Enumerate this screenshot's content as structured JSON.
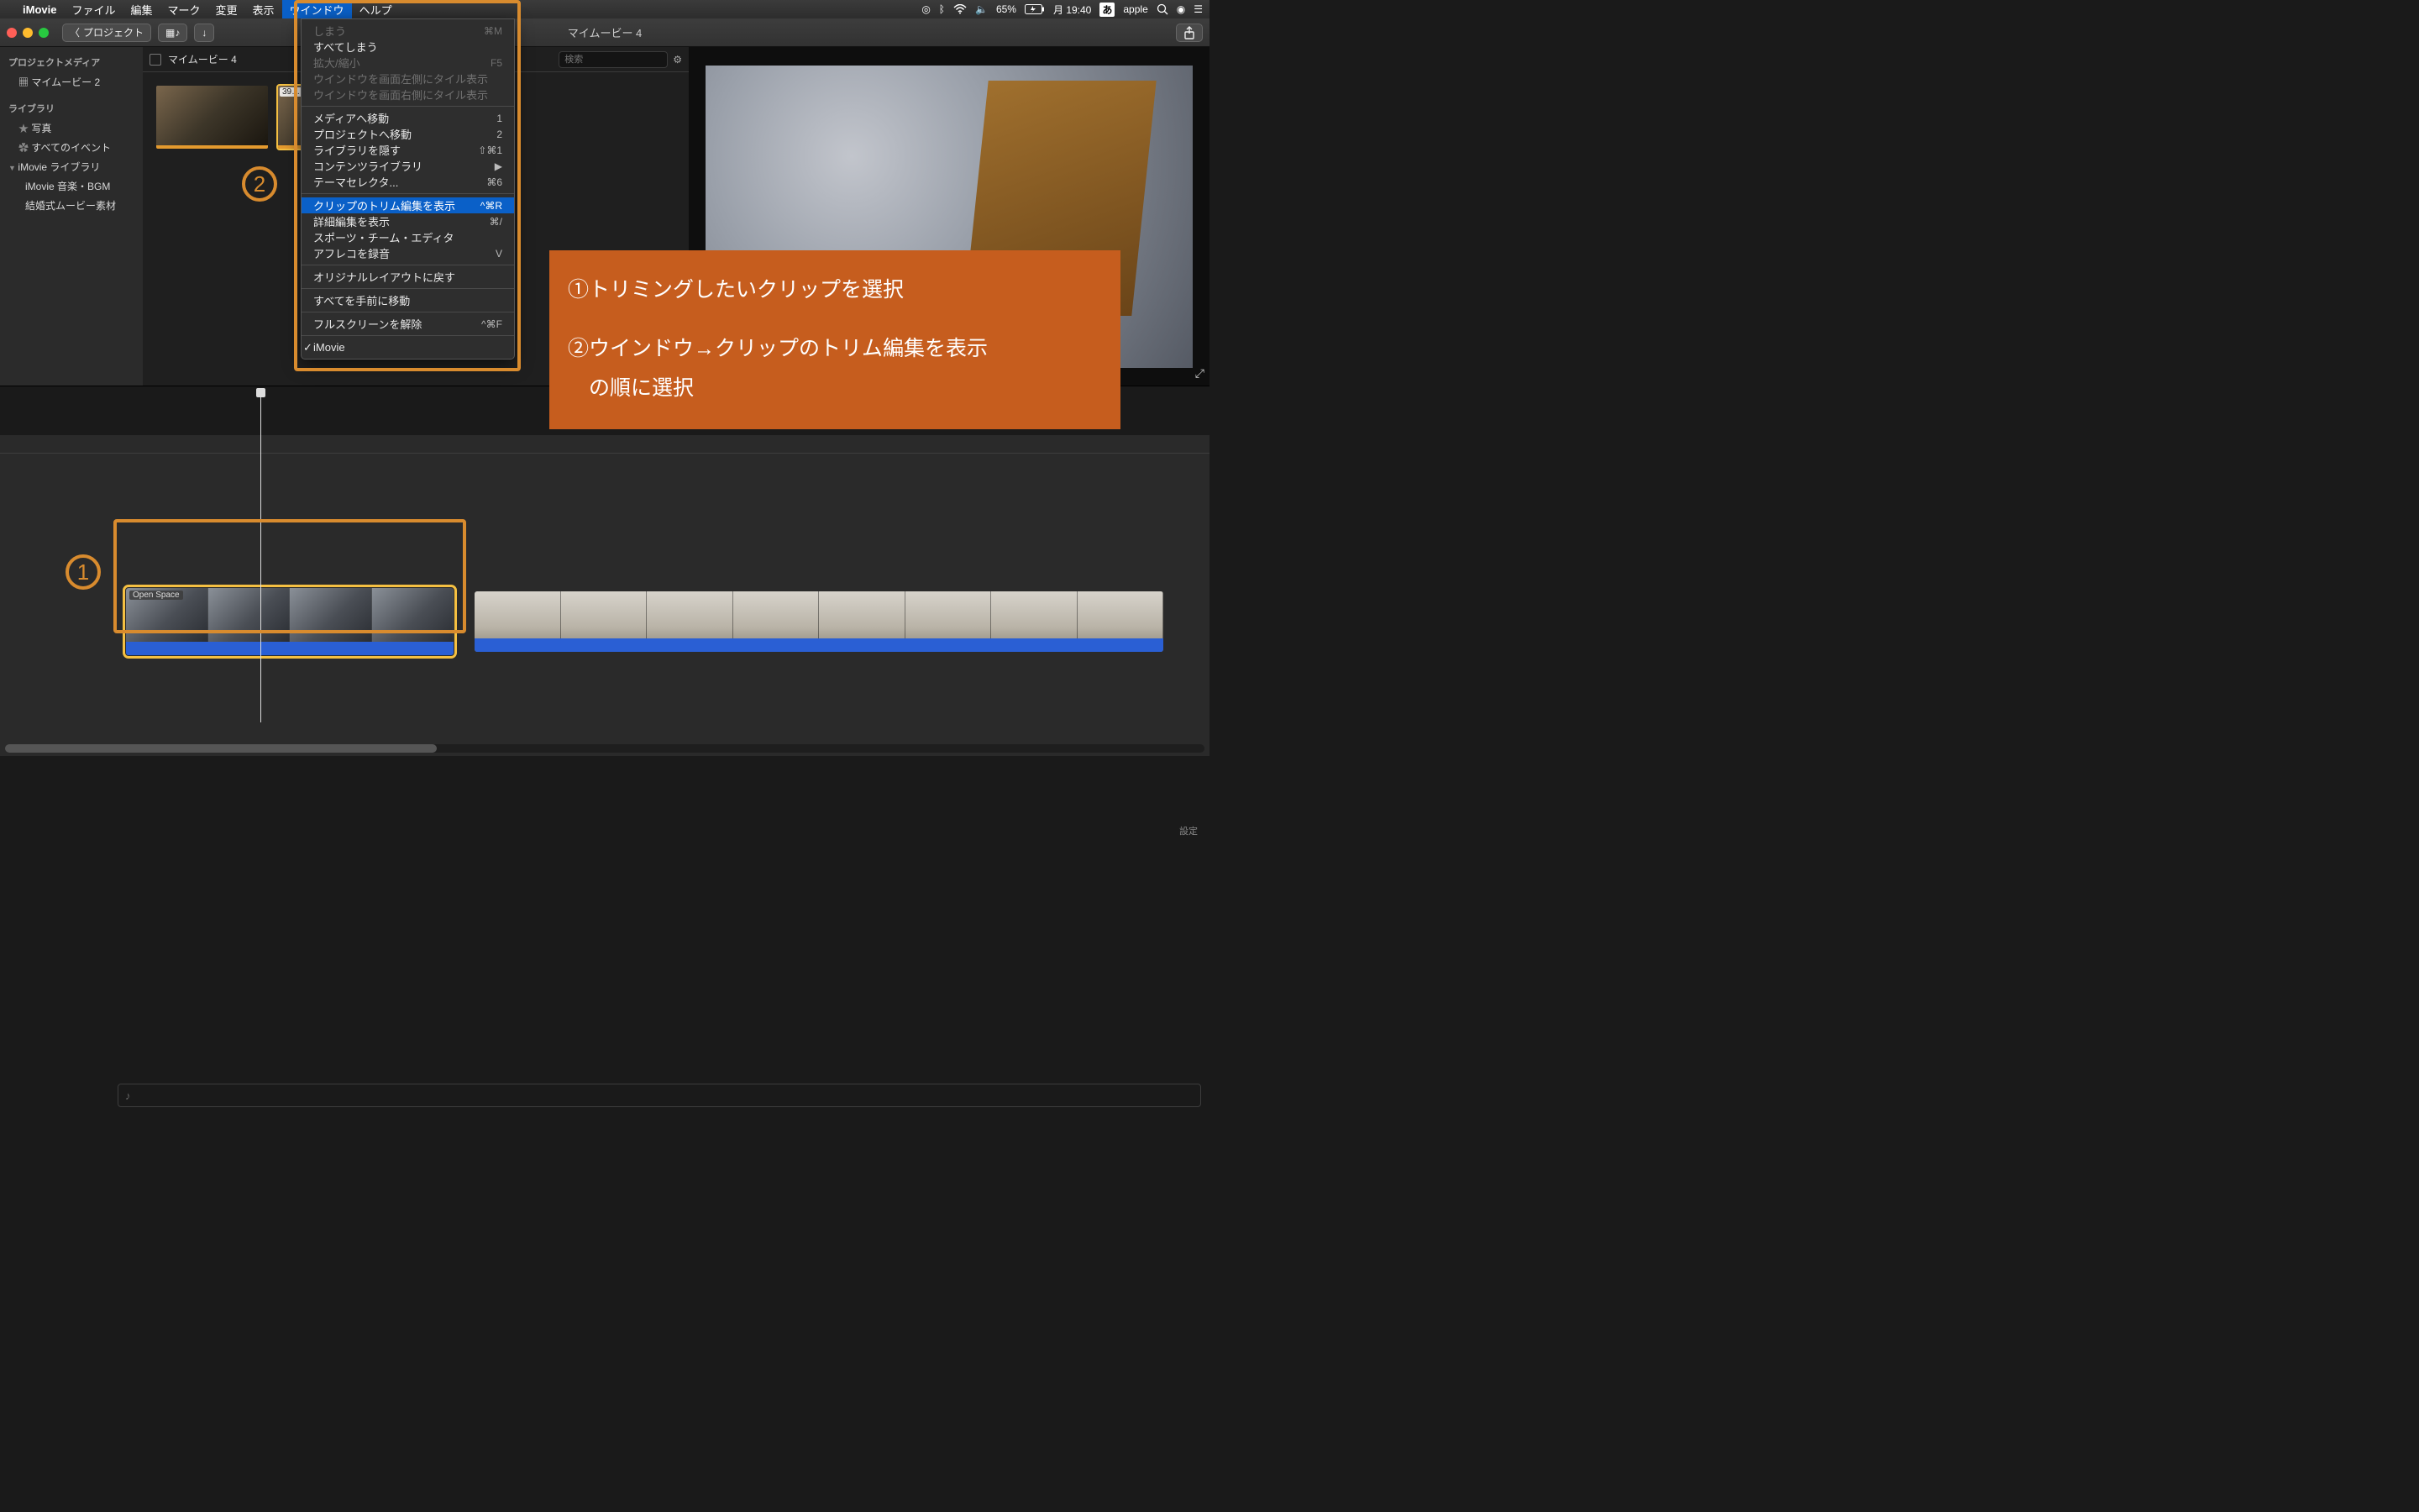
{
  "menubar": {
    "app": "iMovie",
    "items": [
      "ファイル",
      "編集",
      "マーク",
      "変更",
      "表示",
      "ウインドウ",
      "ヘルプ"
    ],
    "selected": "ウインドウ",
    "right": {
      "battery": "65%",
      "date": "月 19:40",
      "input": "あ",
      "user": "apple"
    }
  },
  "toolbar": {
    "back": "プロジェクト",
    "title": "マイムービー 4"
  },
  "sidebar": {
    "sec1": "プロジェクトメディア",
    "proj": "マイムービー 2",
    "sec2": "ライブラリ",
    "photos": "写真",
    "events": "すべてのイベント",
    "lib": "iMovie ライブラリ",
    "bgm": "iMovie 音楽・BGM",
    "wedding": "結婚式ムービー素材"
  },
  "browser": {
    "tab": "マイムービー 4",
    "search_placeholder": "検索",
    "clip_dur": "39…"
  },
  "dropdown": {
    "close": "しまう",
    "close_sc": "⌘M",
    "closeall": "すべてしまう",
    "zoom": "拡大/縮小",
    "zoom_sc": "F5",
    "tile_left": "ウインドウを画面左側にタイル表示",
    "tile_right": "ウインドウを画面右側にタイル表示",
    "to_media": "メディアへ移動",
    "to_media_sc": "1",
    "to_project": "プロジェクトへ移動",
    "to_project_sc": "2",
    "hide_lib": "ライブラリを隠す",
    "hide_lib_sc": "⇧⌘1",
    "content_lib": "コンテンツライブラリ",
    "content_lib_sc": "▶",
    "theme": "テーマセレクタ...",
    "theme_sc": "⌘6",
    "trim": "クリップのトリム編集を表示",
    "trim_sc": "^⌘R",
    "detail": "詳細編集を表示",
    "detail_sc": "⌘/",
    "sports": "スポーツ・チーム・エディタ",
    "afreco": "アフレコを録音",
    "afreco_sc": "V",
    "reset": "オリジナルレイアウトに戻す",
    "front": "すべてを手前に移動",
    "fullscreen": "フルスクリーンを解除",
    "fullscreen_sc": "^⌘F",
    "imovie": "iMovie"
  },
  "timeline": {
    "clip_label": "Open Space",
    "settings": "設定"
  },
  "annotations": {
    "n1": "①",
    "n1_full": "1",
    "n2": "②",
    "n2_full": "2",
    "line1": "①トリミングしたいクリップを選択",
    "line2": "②ウインドウ→クリップのトリム編集を表示",
    "line3": "　の順に選択"
  }
}
